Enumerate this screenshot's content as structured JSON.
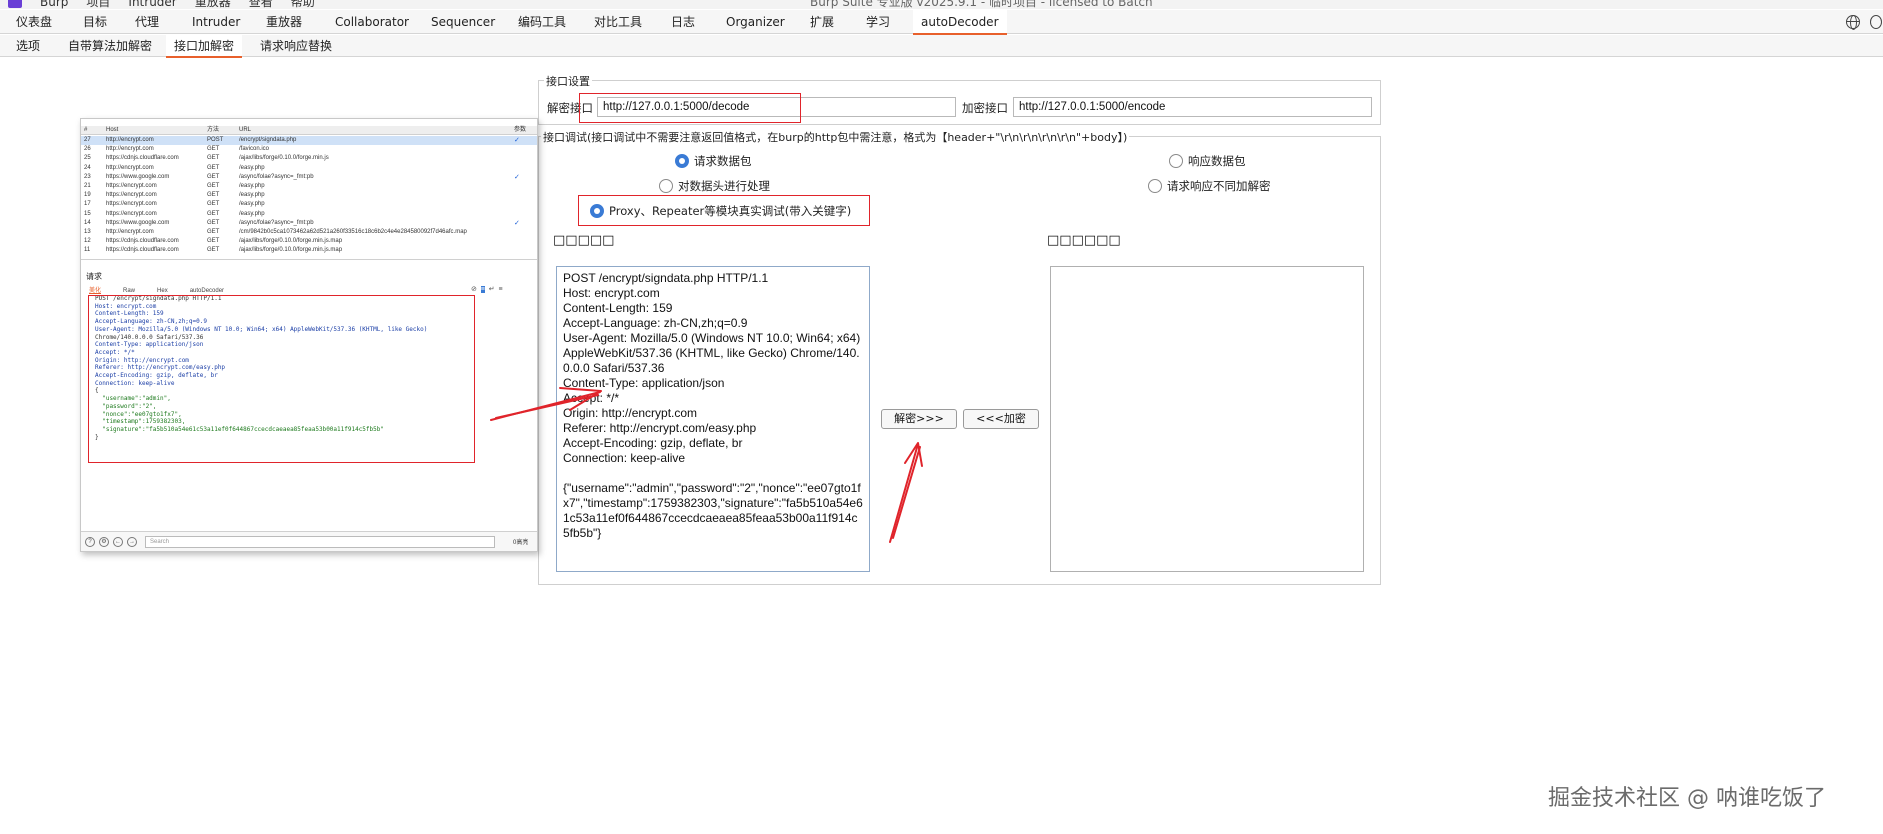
{
  "title_menu": [
    "Burp",
    "项目",
    "Intruder",
    "重放器",
    "查看",
    "帮助"
  ],
  "window_title": "Burp Suite 专业版 v2025.9.1 - 临时项目 - licensed to Batch",
  "main_tabs": [
    "仪表盘",
    "目标",
    "代理",
    "Intruder",
    "重放器",
    "Collaborator",
    "Sequencer",
    "编码工具",
    "对比工具",
    "日志",
    "Organizer",
    "扩展",
    "学习",
    "autoDecoder"
  ],
  "sub_tabs": [
    "选项",
    "自带算法加解密",
    "接口加解密",
    "请求响应替换"
  ],
  "interface_settings": {
    "title": "接口设置",
    "decode_label": "解密接口",
    "decode_url": "http://127.0.0.1:5000/decode",
    "encode_label": "加密接口",
    "encode_url": "http://127.0.0.1:5000/encode"
  },
  "debug": {
    "title": "接口调试(接口调试中不需要注意返回值格式，在burp的http包中需注意，格式为【header+\"\\r\\n\\r\\n\\r\\n\\r\\n\"+body】)",
    "radio_request": "请求数据包",
    "radio_response": "响应数据包",
    "radio_header": "对数据头进行处理",
    "radio_noop": "请求响应不同加解密",
    "radio_proxy": "Proxy、Repeater等模块真实调试(带入关键字)",
    "input_label": "□□□□□",
    "output_label": "□□□□□□",
    "decode_button": "解密>>>",
    "encode_button": "<<<加密",
    "request_text": "POST /encrypt/signdata.php HTTP/1.1\nHost: encrypt.com\nContent-Length: 159\nAccept-Language: zh-CN,zh;q=0.9\nUser-Agent: Mozilla/5.0 (Windows NT 10.0; Win64; x64) AppleWebKit/537.36 (KHTML, like Gecko) Chrome/140.0.0.0 Safari/537.36\nContent-Type: application/json\nAccept: */*\nOrigin: http://encrypt.com\nReferer: http://encrypt.com/easy.php\nAccept-Encoding: gzip, deflate, br\nConnection: keep-alive\n\n{\"username\":\"admin\",\"password\":\"2\",\"nonce\":\"ee07gto1fx7\",\"timestamp\":1759382303,\"signature\":\"fa5b510a54e61c53a11ef0f644867ccecdcaeaea85feaa53b00a11f914c5fb5b\"}",
    "output_text": ""
  },
  "proxy_shot": {
    "columns": [
      "#",
      "Host",
      "方法",
      "URL",
      "参数"
    ],
    "rows": [
      {
        "n": "27",
        "host": "http://encrypt.com",
        "method": "POST",
        "url": "/encrypt/signdata.php",
        "check": "✓"
      },
      {
        "n": "26",
        "host": "http://encrypt.com",
        "method": "GET",
        "url": "/favicon.ico",
        "check": ""
      },
      {
        "n": "25",
        "host": "https://cdnjs.cloudflare.com",
        "method": "GET",
        "url": "/ajax/libs/forge/0.10.0/forge.min.js",
        "check": ""
      },
      {
        "n": "24",
        "host": "http://encrypt.com",
        "method": "GET",
        "url": "/easy.php",
        "check": ""
      },
      {
        "n": "23",
        "host": "https://www.google.com",
        "method": "GET",
        "url": "/async/folae?async=_fmt:pb",
        "check": "✓"
      },
      {
        "n": "21",
        "host": "https://encrypt.com",
        "method": "GET",
        "url": "/easy.php",
        "check": ""
      },
      {
        "n": "19",
        "host": "https://encrypt.com",
        "method": "GET",
        "url": "/easy.php",
        "check": ""
      },
      {
        "n": "17",
        "host": "https://encrypt.com",
        "method": "GET",
        "url": "/easy.php",
        "check": ""
      },
      {
        "n": "15",
        "host": "https://encrypt.com",
        "method": "GET",
        "url": "/easy.php",
        "check": ""
      },
      {
        "n": "14",
        "host": "https://www.google.com",
        "method": "GET",
        "url": "/async/folae?async=_fmt:pb",
        "check": "✓"
      },
      {
        "n": "13",
        "host": "http://encrypt.com",
        "method": "GET",
        "url": "/cm/9842b0c5ca1073462a62d521a260f33516c18c6b2c4e4e284580092f7d46afc.map",
        "check": ""
      },
      {
        "n": "12",
        "host": "https://cdnjs.cloudflare.com",
        "method": "GET",
        "url": "/ajax/libs/forge/0.10.0/forge.min.js.map",
        "check": ""
      },
      {
        "n": "11",
        "host": "https://cdnjs.cloudflare.com",
        "method": "GET",
        "url": "/ajax/libs/forge/0.10.0/forge.min.js.map",
        "check": ""
      }
    ],
    "request_label": "请求",
    "request_tabs": [
      "美化",
      "Raw",
      "Hex",
      "autoDecoder"
    ],
    "code_lines": [
      "POST /encrypt/signdata.php HTTP/1.1",
      "Host: encrypt.com",
      "Content-Length: 159",
      "Accept-Language: zh-CN,zh;q=0.9",
      "User-Agent: Mozilla/5.0 (Windows NT 10.0; Win64; x64) AppleWebKit/537.36 (KHTML, like Gecko)",
      "Chrome/140.0.0.0 Safari/537.36",
      "Content-Type: application/json",
      "Accept: */*",
      "Origin: http://encrypt.com",
      "Referer: http://encrypt.com/easy.php",
      "Accept-Encoding: gzip, deflate, br",
      "Connection: keep-alive",
      "",
      "{",
      "  \"username\":\"admin\",",
      "  \"password\":\"2\",",
      "  \"nonce\":\"ee07gto1fx7\",",
      "  \"timestamp\":1759382303,",
      "  \"signature\":\"fa5b510a54e61c53a11ef0f644867ccecdcaeaea85feaa53b00a11f914c5fb5b\"",
      "}"
    ],
    "search_placeholder": "Search",
    "matches_label": "0高亮"
  },
  "watermark": "掘金技术社区 @ 呐谁吃饭了",
  "colors": {
    "accent": "#e8602c",
    "annotation": "#e0242b",
    "radio": "#3a7bd5"
  }
}
